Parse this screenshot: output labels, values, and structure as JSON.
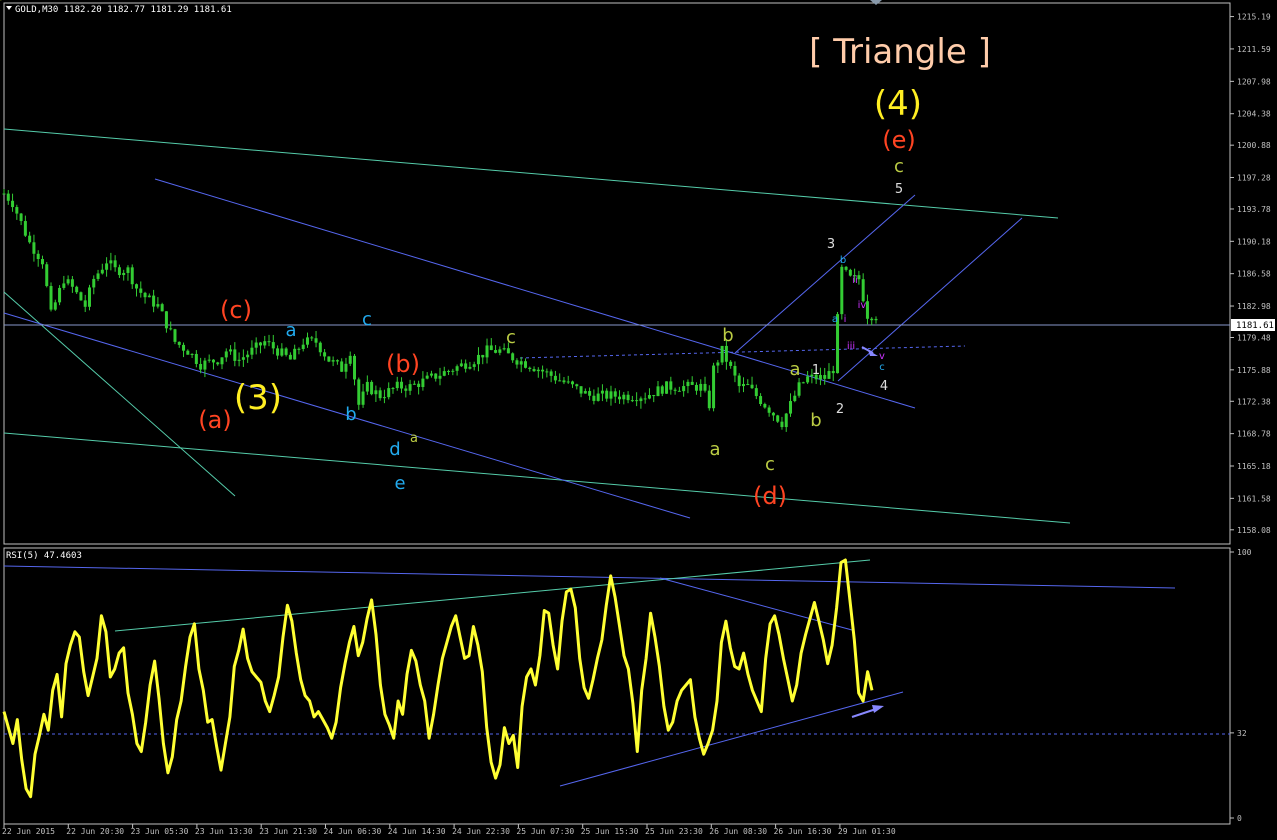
{
  "main_header": "GOLD,M30  1182.20 1182.77 1181.29 1181.61",
  "rsi_header": "RSI(5) 47.4603",
  "price_tag": "1181.61",
  "colors": {
    "background": "#000000",
    "candle": "#33cc33",
    "rsi_line": "#ffff33",
    "channel_blue": "#5566ee",
    "trend_teal": "#55ccaa",
    "grid_axis": "#c0c0c0",
    "wave_red": "#ff4422",
    "wave_yellow": "#ffee22",
    "wave_cyan": "#22aaee",
    "wave_olive": "#bbcc44",
    "wave_white": "#dddddd",
    "wave_magenta": "#cc33ff"
  },
  "chart_data": [
    {
      "type": "candlestick",
      "symbol": "GOLD",
      "timeframe": "M30",
      "ylim": [
        1156.5,
        1216.7
      ],
      "y_ticks": [
        "1215.19",
        "1211.59",
        "1207.98",
        "1204.38",
        "1200.88",
        "1197.28",
        "1193.78",
        "1190.18",
        "1186.58",
        "1182.98",
        "1179.48",
        "1175.88",
        "1172.38",
        "1168.78",
        "1165.18",
        "1161.58",
        "1158.08"
      ],
      "x_ticks": [
        "22 Jun 2015",
        "22 Jun 20:30",
        "23 Jun 05:30",
        "23 Jun 13:30",
        "23 Jun 21:30",
        "24 Jun 06:30",
        "24 Jun 14:30",
        "24 Jun 22:30",
        "25 Jun 07:30",
        "25 Jun 15:30",
        "25 Jun 23:30",
        "26 Jun 08:30",
        "26 Jun 16:30",
        "29 Jun 01:30"
      ],
      "price_path": [
        [
          0,
          1195.5
        ],
        [
          2,
          1194.5
        ],
        [
          6,
          1190
        ],
        [
          9,
          1188
        ],
        [
          11,
          1182
        ],
        [
          14,
          1186
        ],
        [
          16,
          1185
        ],
        [
          19,
          1183
        ],
        [
          21,
          1186
        ],
        [
          24,
          1188
        ],
        [
          26,
          1187
        ],
        [
          29,
          1187
        ],
        [
          31,
          1185
        ],
        [
          33,
          1184
        ],
        [
          36,
          1183
        ],
        [
          40,
          1179
        ],
        [
          43,
          1178
        ],
        [
          46,
          1176.5
        ],
        [
          50,
          1177
        ],
        [
          52,
          1178
        ],
        [
          55,
          1177
        ],
        [
          58,
          1178
        ],
        [
          61,
          1179
        ],
        [
          64,
          1178
        ],
        [
          67,
          1177
        ],
        [
          70,
          1179
        ],
        [
          73,
          1179
        ],
        [
          76,
          1177
        ],
        [
          79,
          1176
        ],
        [
          81,
          1178
        ],
        [
          83,
          1172
        ],
        [
          85,
          1174
        ],
        [
          88,
          1173
        ],
        [
          92,
          1174
        ],
        [
          95,
          1174
        ],
        [
          100,
          1175
        ],
        [
          105,
          1176
        ],
        [
          110,
          1177
        ],
        [
          113,
          1178
        ],
        [
          116,
          1178
        ],
        [
          120,
          1177
        ],
        [
          125,
          1176
        ],
        [
          129,
          1175
        ],
        [
          133,
          1174
        ],
        [
          137,
          1173
        ],
        [
          141,
          1173
        ],
        [
          145,
          1173
        ],
        [
          150,
          1173
        ],
        [
          155,
          1174
        ],
        [
          160,
          1174
        ],
        [
          163,
          1174
        ],
        [
          165,
          1172
        ],
        [
          166,
          1176
        ],
        [
          168,
          1178
        ],
        [
          170,
          1176
        ],
        [
          172,
          1174
        ],
        [
          174,
          1174
        ],
        [
          176,
          1173
        ],
        [
          178,
          1172
        ],
        [
          180,
          1171
        ],
        [
          182,
          1170
        ],
        [
          184,
          1172
        ],
        [
          186,
          1174
        ],
        [
          188,
          1175
        ],
        [
          190,
          1175
        ],
        [
          192,
          1175
        ],
        [
          194,
          1176
        ],
        [
          196,
          1187
        ],
        [
          198,
          1186
        ],
        [
          200,
          1186
        ],
        [
          201,
          1184
        ],
        [
          202,
          1182
        ],
        [
          204,
          1182
        ]
      ],
      "series": [
        {
          "name": "",
          "values": "price_path"
        }
      ]
    },
    {
      "type": "line",
      "indicator": "RSI(5)",
      "ylim": [
        0,
        100
      ],
      "y_ticks": [
        "100",
        "32",
        "0"
      ],
      "values": [
        40,
        34,
        28,
        37,
        22,
        11,
        8,
        24,
        31,
        39,
        33,
        48,
        54,
        38,
        58,
        65,
        70,
        68,
        55,
        46,
        53,
        60,
        76,
        70,
        53,
        56,
        62,
        64,
        47,
        39,
        28,
        25,
        36,
        50,
        59,
        45,
        28,
        17,
        23,
        37,
        44,
        57,
        68,
        73,
        56,
        48,
        36,
        37,
        27,
        18,
        28,
        38,
        57,
        63,
        71,
        60,
        55,
        53,
        51,
        44,
        40,
        46,
        53,
        68,
        80,
        74,
        62,
        52,
        46,
        44,
        38,
        40,
        37,
        34,
        30,
        36,
        49,
        58,
        66,
        72,
        61,
        66,
        75,
        82,
        69,
        50,
        39,
        35,
        30,
        44,
        39,
        54,
        63,
        59,
        50,
        44,
        30,
        39,
        50,
        60,
        66,
        72,
        76,
        68,
        60,
        61,
        72,
        65,
        55,
        34,
        21,
        15,
        20,
        34,
        28,
        31,
        19,
        42,
        53,
        56,
        50,
        61,
        78,
        77,
        65,
        56,
        74,
        85,
        86,
        79,
        60,
        49,
        45,
        52,
        60,
        67,
        80,
        91,
        83,
        72,
        61,
        56,
        43,
        25,
        48,
        60,
        77,
        68,
        57,
        42,
        33,
        36,
        44,
        48,
        50,
        52,
        38,
        30,
        24,
        28,
        33,
        44,
        66,
        74,
        64,
        57,
        56,
        62,
        54,
        48,
        44,
        40,
        60,
        73,
        76,
        69,
        60,
        52,
        44,
        50,
        62,
        69,
        75,
        81,
        74,
        67,
        58,
        65,
        79,
        96,
        97,
        82,
        67,
        47,
        44,
        55,
        48
      ]
    }
  ],
  "wave_labels": [
    {
      "text": "[ Triangle ]",
      "color": "#ffccaa",
      "size": "xl"
    },
    {
      "text": "(4)",
      "color": "#ffee22",
      "size": "lg"
    },
    {
      "text": "(e)",
      "color": "#ff4422",
      "size": "md"
    },
    {
      "text": "c",
      "color": "#bbcc44",
      "size": "sm"
    },
    {
      "text": "5",
      "color": "#dddddd",
      "size": "xs"
    },
    {
      "text": "3",
      "color": "#dddddd",
      "size": "xs"
    },
    {
      "text": "b",
      "color": "#22aaee",
      "size": "xxs"
    },
    {
      "text": "ii",
      "color": "#cc33ff",
      "size": "xxs"
    },
    {
      "text": "iv",
      "color": "#cc33ff",
      "size": "xxs"
    },
    {
      "text": "a",
      "color": "#22aaee",
      "size": "xxs"
    },
    {
      "text": "i",
      "color": "#cc33ff",
      "size": "xxs"
    },
    {
      "text": "iii",
      "color": "#cc33ff",
      "size": "xxs"
    },
    {
      "text": "v",
      "color": "#cc33ff",
      "size": "xxs"
    },
    {
      "text": "c",
      "color": "#22aaee",
      "size": "xxs"
    },
    {
      "text": "4",
      "color": "#dddddd",
      "size": "xs"
    },
    {
      "text": "1",
      "color": "#dddddd",
      "size": "xs"
    },
    {
      "text": "2",
      "color": "#dddddd",
      "size": "xs"
    },
    {
      "text": "a",
      "color": "#bbcc44",
      "size": "sm"
    },
    {
      "text": "b",
      "color": "#bbcc44",
      "size": "sm"
    },
    {
      "text": "c",
      "color": "#bbcc44",
      "size": "sm"
    },
    {
      "text": "(d)",
      "color": "#ff4422",
      "size": "md"
    },
    {
      "text": "b",
      "color": "#bbcc44",
      "size": "sm"
    },
    {
      "text": "a",
      "color": "#bbcc44",
      "size": "sm"
    },
    {
      "text": "c",
      "color": "#bbcc44",
      "size": "sm"
    },
    {
      "text": "(c)",
      "color": "#ff4422",
      "size": "md"
    },
    {
      "text": "(a)",
      "color": "#ff4422",
      "size": "md"
    },
    {
      "text": "(3)",
      "color": "#ffee22",
      "size": "lg"
    },
    {
      "text": "a",
      "color": "#22aaee",
      "size": "sm"
    },
    {
      "text": "b",
      "color": "#22aaee",
      "size": "sm"
    },
    {
      "text": "c",
      "color": "#22aaee",
      "size": "sm"
    },
    {
      "text": "d",
      "color": "#22aaee",
      "size": "sm"
    },
    {
      "text": "e",
      "color": "#22aaee",
      "size": "sm"
    },
    {
      "text": "(b)",
      "color": "#ff4422",
      "size": "md"
    },
    {
      "text": "a",
      "color": "#bbcc44",
      "size": "xs"
    },
    {
      "text": "b",
      "color": "#bbcc44",
      "size": "sm"
    }
  ]
}
